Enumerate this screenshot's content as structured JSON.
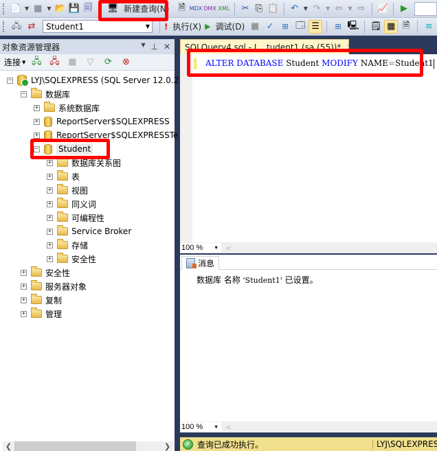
{
  "toolbar1": {
    "new_query_label": "新建查询(N)",
    "icons": [
      "new-project-icon",
      "add-item-icon",
      "open-file-icon",
      "save-icon",
      "save-all-icon",
      "new-query-icon",
      "database-engine-query-icon",
      "mdx-query-icon",
      "dmx-query-icon",
      "xmla-query-icon",
      "cut-icon",
      "copy-icon",
      "paste-icon",
      "undo-icon",
      "redo-icon",
      "navigate-backward-icon",
      "navigate-forward-icon",
      "activity-monitor-icon",
      "start-icon"
    ]
  },
  "toolbar2": {
    "database_selected": "Student1",
    "execute_label": "执行(X)",
    "debug_label": "调试(D)"
  },
  "object_explorer": {
    "title": "对象资源管理器",
    "connect_label": "连接",
    "tree": {
      "server": "LYJ\\SQLEXPRESS (SQL Server 12.0.2",
      "databases_folder": "数据库",
      "system_databases": "系统数据库",
      "db1": "ReportServer$SQLEXPRESS",
      "db2": "ReportServer$SQLEXPRESSTe",
      "selected_db": "Student",
      "children": [
        "数据库关系图",
        "表",
        "视图",
        "同义词",
        "可编程性",
        "Service Broker",
        "存储",
        "安全性"
      ],
      "server_children": [
        "安全性",
        "服务器对象",
        "复制",
        "管理"
      ]
    }
  },
  "editor": {
    "tab_title": "SQLQuery4.sql - L...tudent1 (sa (55))*",
    "code": {
      "kw1": "ALTER",
      "kw2": "DATABASE",
      "ident1": "Student",
      "kw3": "MODIFY",
      "kw4": "NAME",
      "op": "=",
      "ident2": "Student1"
    },
    "zoom_level": "100 %"
  },
  "results": {
    "tab_label": "消息",
    "message_prefix": "数据库 名称",
    "message_literal": "'Student1'",
    "message_suffix": "已设置。",
    "zoom_level": "100 %"
  },
  "status": {
    "message": "查询已成功执行。",
    "server": "LYJ\\SQLEXPRESS"
  },
  "colors": {
    "keyword": "#0000ff",
    "highlight": "#ff0000",
    "status_bar": "#f0e08e",
    "tab_active": "#fff5c8"
  }
}
